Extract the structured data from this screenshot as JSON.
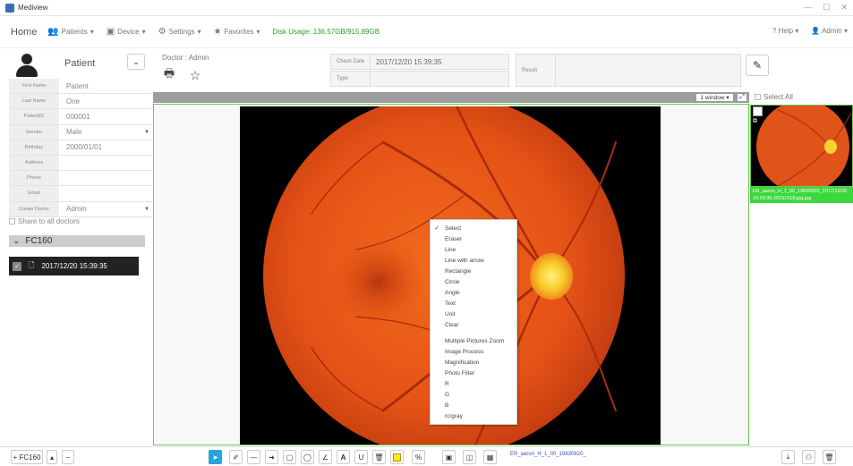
{
  "app": {
    "title": "Mediview"
  },
  "menu": {
    "home": "Home",
    "patients": "Patients",
    "device": "Device",
    "settings": "Settings",
    "favorites": "Favorites",
    "disk_usage": "Disk Usage: 136.57GB/915.89GB",
    "help": "Help",
    "admin": "Admin"
  },
  "patient": {
    "header_name": "Patient",
    "doctor": "Doctor : Admin",
    "fields": [
      {
        "label": "First Name",
        "value": "Patient"
      },
      {
        "label": "Last Name",
        "value": "One"
      },
      {
        "label": "PatientID",
        "value": "000001"
      },
      {
        "label": "Gender",
        "value": "Male"
      },
      {
        "label": "Birthday",
        "value": "2000/01/01"
      },
      {
        "label": "Address",
        "value": ""
      },
      {
        "label": "Phone",
        "value": ""
      },
      {
        "label": "Email",
        "value": ""
      },
      {
        "label": "Create Doctor",
        "value": "Admin"
      }
    ],
    "share_label": "Share to all doctors"
  },
  "exam": {
    "check_date_label": "Check Date",
    "check_date": "2017/12/20 15:39:35",
    "type_label": "Type",
    "type": "",
    "result_label": "Result",
    "result": ""
  },
  "device_group": {
    "name": "FC160",
    "exam_item": "2017/12/20 15:39:35"
  },
  "viewer": {
    "window_mode": "1 window"
  },
  "context_menu": {
    "group1": [
      "Select",
      "Eraser",
      "Line",
      "Line with arrow",
      "Rectangle",
      "Circle",
      "Angle",
      "Text",
      "Unit",
      "Clear"
    ],
    "group2": [
      "Multiple Pictures Zoom",
      "Image Process",
      "Magnification",
      "Photo Filter",
      "R",
      "G",
      "B",
      "rc/gray"
    ],
    "checked": "Select"
  },
  "thumbnails": {
    "select_all": "Select All",
    "caption": "ER_aaron_H_1_00_19830820_2017/12/20 15:39:35 20151018.jpg.jpg"
  },
  "bottom": {
    "device_button": "+ FC160",
    "file_name": "ER_aaron_H_1_00_19830820_"
  },
  "colors": {
    "accent_green": "#6cc84c",
    "disk_green": "#2e9c2e",
    "tool_blue": "#29a3e0",
    "highlight_yellow": "#ffee00"
  }
}
